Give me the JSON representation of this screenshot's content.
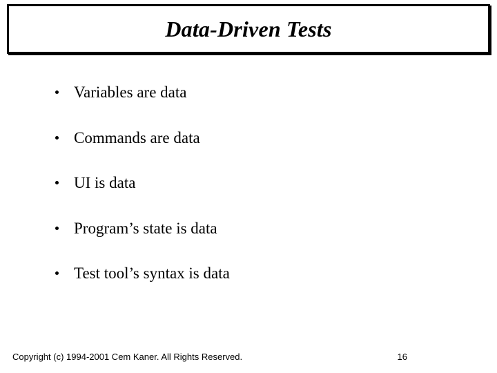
{
  "title": "Data-Driven Tests",
  "bullets": [
    "Variables are data",
    "Commands are data",
    "UI is data",
    "Program’s state is data",
    "Test tool’s syntax is data"
  ],
  "footer": {
    "copyright": "Copyright (c) 1994-2001 Cem Kaner. All Rights Reserved.",
    "page": "16"
  }
}
